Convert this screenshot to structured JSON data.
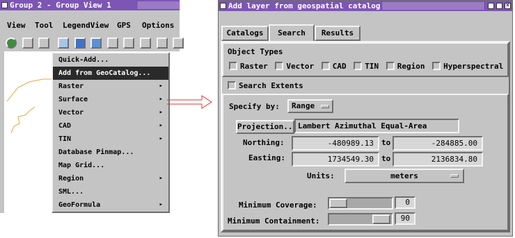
{
  "group_window": {
    "title": "Group 2 - Group View 1",
    "menu": [
      "View",
      "Tool",
      "LegendView",
      "GPS",
      "Options"
    ],
    "toolbar_icons": [
      "zoom-fit-icon",
      "play-icon",
      "window-icon",
      "add-layer-icon",
      "select-icon",
      "pan-icon",
      "query-icon",
      "zoom-in-icon",
      "zoom-out-icon",
      "zoom-box-icon",
      "zoom-extent-icon"
    ]
  },
  "context_menu": {
    "items": [
      {
        "label": "Quick-Add...",
        "submenu": false,
        "highlighted": false
      },
      {
        "label": "Add from GeoCatalog...",
        "submenu": false,
        "highlighted": true
      },
      {
        "label": "Raster",
        "submenu": true,
        "highlighted": false
      },
      {
        "label": "Surface",
        "submenu": true,
        "highlighted": false
      },
      {
        "label": "Vector",
        "submenu": true,
        "highlighted": false
      },
      {
        "label": "CAD",
        "submenu": true,
        "highlighted": false
      },
      {
        "label": "TIN",
        "submenu": true,
        "highlighted": false
      },
      {
        "label": "Database Pinmap...",
        "submenu": false,
        "highlighted": false
      },
      {
        "label": "Map Grid...",
        "submenu": false,
        "highlighted": false
      },
      {
        "label": "Region",
        "submenu": true,
        "highlighted": false
      },
      {
        "label": "SML...",
        "submenu": false,
        "highlighted": false
      },
      {
        "label": "GeoFormula",
        "submenu": true,
        "highlighted": false
      }
    ]
  },
  "dialog": {
    "title": "Add layer from geospatial catalog",
    "tabs": [
      "Catalogs",
      "Search",
      "Results"
    ],
    "object_types_label": "Object Types",
    "object_types": [
      "Raster",
      "Vector",
      "CAD",
      "TIN",
      "Region",
      "Hyperspectral"
    ],
    "search_extents_label": "Search Extents",
    "specify_by_label": "Specify by:",
    "specify_by_value": "Range",
    "projection_button": "Projection...",
    "projection_value": "Lambert Azimuthal Equal-Area",
    "northing_label": "Northing:",
    "northing_from": "-480989.13",
    "northing_to": "-284885.00",
    "easting_label": "Easting:",
    "easting_from": "1734549.30",
    "easting_to": "2136834.80",
    "to_label": "to",
    "units_label": "Units:",
    "units_value": "meters",
    "min_coverage_label": "Minimum Coverage:",
    "min_coverage_value": "0",
    "min_containment_label": "Minimum Containment:",
    "min_containment_value": "90"
  },
  "colors": {
    "titlebar": "#7d55b4",
    "panel": "#c4c4c4",
    "highlight": "#2a2a2a",
    "connector_arrow": "#e0342c",
    "map_lines": "#e0a840"
  }
}
